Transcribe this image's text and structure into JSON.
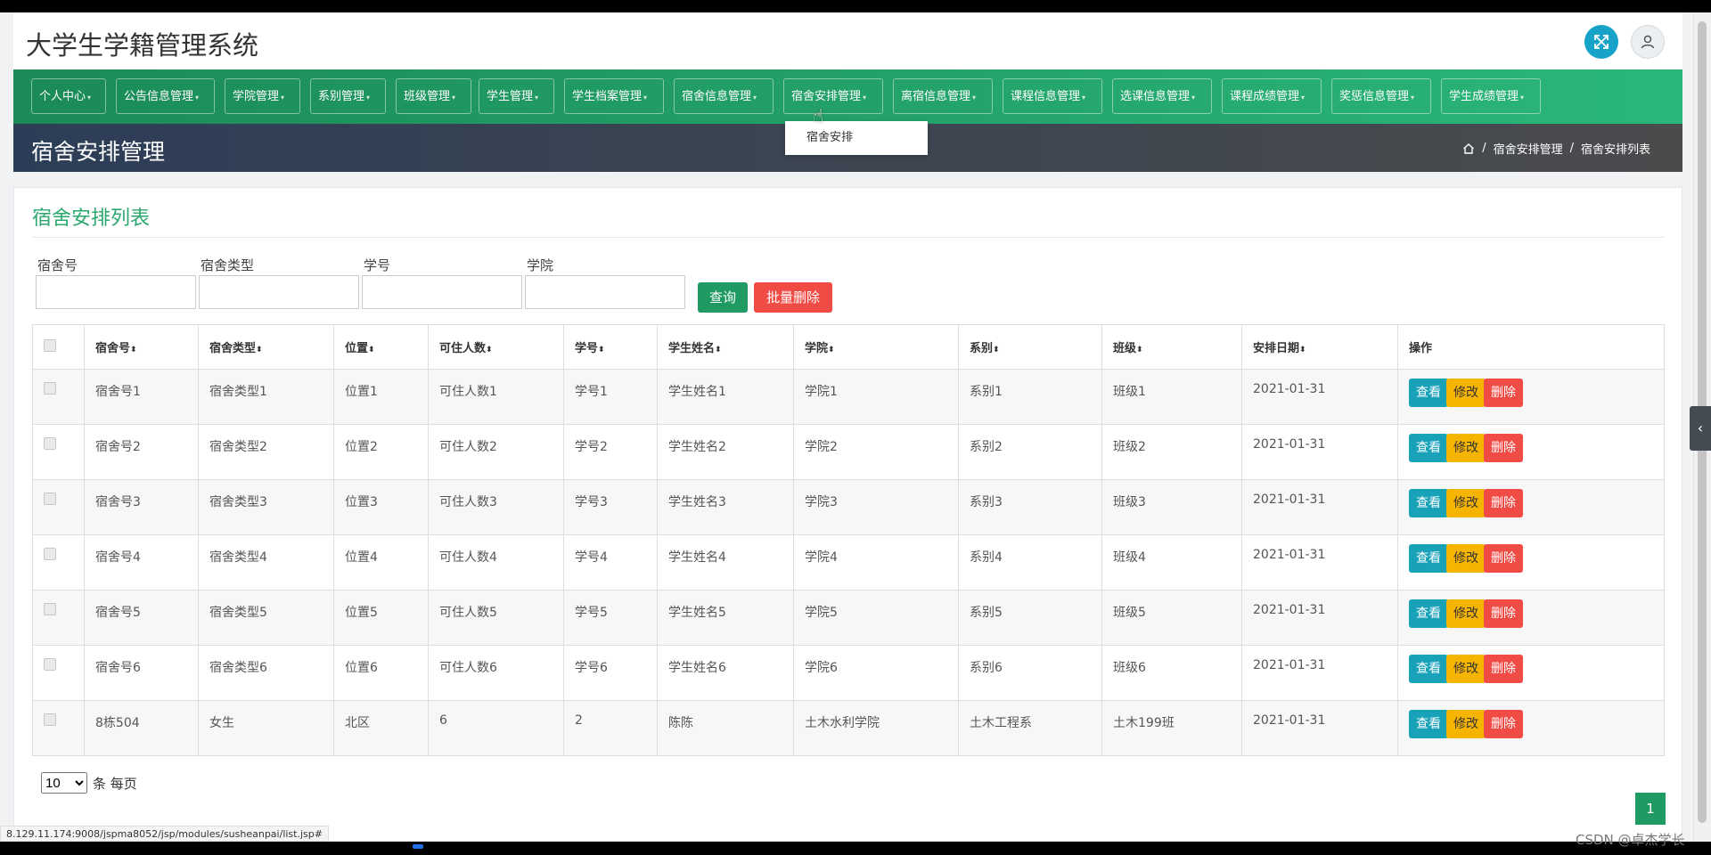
{
  "header": {
    "system_title": "大学生学籍管理系统"
  },
  "nav": {
    "items": [
      {
        "label": "个人中心"
      },
      {
        "label": "公告信息管理"
      },
      {
        "label": "学院管理"
      },
      {
        "label": "系别管理"
      },
      {
        "label": "班级管理"
      },
      {
        "label": "学生管理"
      },
      {
        "label": "学生档案管理"
      },
      {
        "label": "宿舍信息管理"
      },
      {
        "label": "宿舍安排管理"
      },
      {
        "label": "离宿信息管理"
      },
      {
        "label": "课程信息管理"
      },
      {
        "label": "选课信息管理"
      },
      {
        "label": "课程成绩管理"
      },
      {
        "label": "奖惩信息管理"
      },
      {
        "label": "学生成绩管理"
      }
    ],
    "dropdown_item": "宿舍安排"
  },
  "title_strip": {
    "page_title": "宿舍安排管理",
    "breadcrumb": [
      "宿舍安排管理",
      "宿舍安排列表"
    ],
    "separator": "/"
  },
  "list": {
    "title": "宿舍安排列表",
    "filters": [
      {
        "label": "宿舍号",
        "value": ""
      },
      {
        "label": "宿舍类型",
        "value": ""
      },
      {
        "label": "学号",
        "value": ""
      },
      {
        "label": "学院",
        "value": ""
      }
    ],
    "query_button": "查询",
    "batch_delete_button": "批量删除",
    "columns": [
      "宿舍号",
      "宿舍类型",
      "位置",
      "可住人数",
      "学号",
      "学生姓名",
      "学院",
      "系别",
      "班级",
      "安排日期",
      "操作"
    ],
    "sort_glyph": "⬍",
    "rows": [
      [
        "宿舍号1",
        "宿舍类型1",
        "位置1",
        "可住人数1",
        "学号1",
        "学生姓名1",
        "学院1",
        "系别1",
        "班级1",
        "2021-01-31"
      ],
      [
        "宿舍号2",
        "宿舍类型2",
        "位置2",
        "可住人数2",
        "学号2",
        "学生姓名2",
        "学院2",
        "系别2",
        "班级2",
        "2021-01-31"
      ],
      [
        "宿舍号3",
        "宿舍类型3",
        "位置3",
        "可住人数3",
        "学号3",
        "学生姓名3",
        "学院3",
        "系别3",
        "班级3",
        "2021-01-31"
      ],
      [
        "宿舍号4",
        "宿舍类型4",
        "位置4",
        "可住人数4",
        "学号4",
        "学生姓名4",
        "学院4",
        "系别4",
        "班级4",
        "2021-01-31"
      ],
      [
        "宿舍号5",
        "宿舍类型5",
        "位置5",
        "可住人数5",
        "学号5",
        "学生姓名5",
        "学院5",
        "系别5",
        "班级5",
        "2021-01-31"
      ],
      [
        "宿舍号6",
        "宿舍类型6",
        "位置6",
        "可住人数6",
        "学号6",
        "学生姓名6",
        "学院6",
        "系别6",
        "班级6",
        "2021-01-31"
      ],
      [
        "8栋504",
        "女生",
        "北区",
        "6",
        "2",
        "陈陈",
        "土木水利学院",
        "土木工程系",
        "土木199班",
        "2021-01-31"
      ]
    ],
    "actions": {
      "view": "查看",
      "edit": "修改",
      "delete": "删除"
    },
    "page_size": "10",
    "page_size_suffix": "条 每页",
    "current_page": "1"
  },
  "browser": {
    "status_url": "8.129.11.174:9008/jspma8052/jsp/modules/susheanpai/list.jsp#",
    "watermark": "CSDN @卓杰学长"
  },
  "colors": {
    "accent_green": "#1e9a62",
    "title_green": "#2ba86d",
    "view_blue": "#17a2b8",
    "edit_yellow": "#f5b400",
    "delete_red": "#f14b46"
  }
}
